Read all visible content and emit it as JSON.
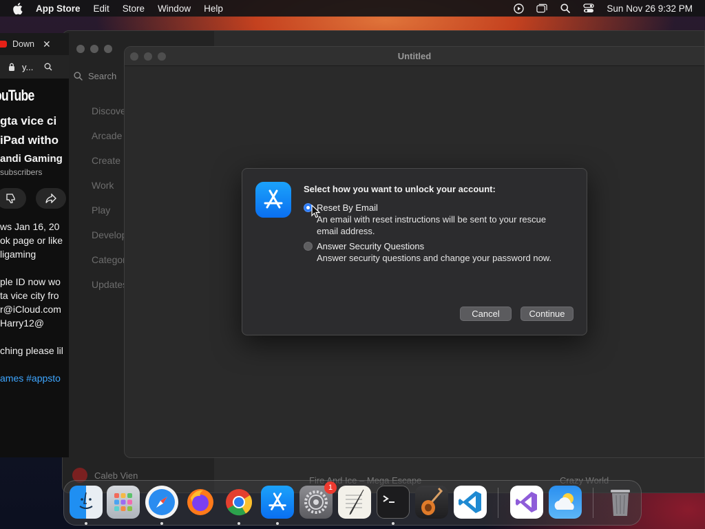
{
  "menubar": {
    "app_name": "App Store",
    "items": [
      "Edit",
      "Store",
      "Window",
      "Help"
    ],
    "datetime": "Sun Nov 26  9:32 PM"
  },
  "browser": {
    "tab_title": "Down",
    "url": "y...",
    "logo": "ouTube",
    "video_title_line1": "gta vice ci",
    "video_title_line2": "iPad witho",
    "channel": "andi Gaming",
    "subscribers": "subscribers",
    "desc": {
      "line1": "ws  Jan 16, 20",
      "line2": "ok page or like",
      "line3": "ligaming",
      "line4": "ple ID now wo",
      "line5": "ta vice city fro",
      "line6": "r@iCloud.com",
      "line7": "Harry12@",
      "line8": "ching please lil",
      "line9": "ames #appsto"
    }
  },
  "appstore": {
    "search_placeholder": "Search",
    "nav": [
      "Discover",
      "Arcade",
      "Create",
      "Work",
      "Play",
      "Develop",
      "Categories",
      "Updates"
    ],
    "user": "Caleb Vien",
    "bottom_item1": "Fire And Ice – Mega Escape",
    "bottom_item2": "Crazy World"
  },
  "window": {
    "title": "Untitled"
  },
  "dialog": {
    "prompt": "Select how you want to unlock your account:",
    "option1": {
      "label": "Reset By Email",
      "desc_line1": "An email with reset instructions will be sent to your rescue",
      "desc_line2": "email address.",
      "selected": true
    },
    "option2": {
      "label": "Answer Security Questions",
      "desc_line1": "Answer security questions and change your password now.",
      "selected": false
    },
    "cancel_label": "Cancel",
    "continue_label": "Continue"
  },
  "dock": {
    "apps": [
      "Finder",
      "Launchpad",
      "Safari",
      "Firefox",
      "Google Chrome",
      "App Store",
      "System Settings",
      "TextEdit",
      "Terminal",
      "GarageBand",
      "Visual Studio Code",
      "Visual Studio",
      "Weather",
      "Trash"
    ],
    "system_settings_badge": "1"
  },
  "colors": {
    "accent": "#2d7cf6",
    "dialog_bg": "#2c2c2e",
    "window_bg": "#2a2a2a"
  }
}
